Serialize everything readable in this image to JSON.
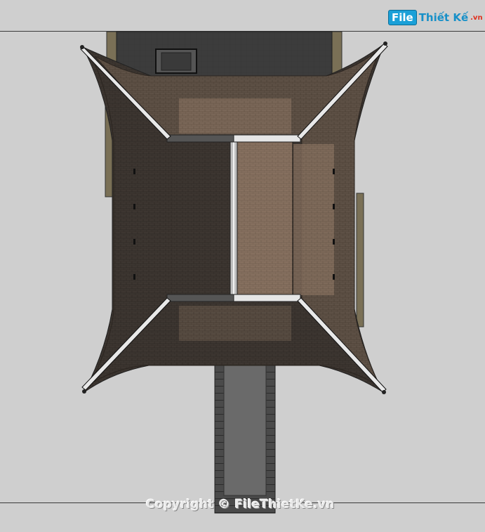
{
  "logo": {
    "file": "File",
    "name": "Thiết Kế",
    "domain": ".vn"
  },
  "watermark": "Copyright © FileThietKe.vn",
  "colors": {
    "background": "#cfcfcf",
    "roof_dark": "#3b3530",
    "roof_mid": "#6a5a4c",
    "roof_light": "#8a7665",
    "ridge": "#d8d8d8",
    "platform": "#4a4a4a",
    "walkway": "#6a6a6a"
  }
}
